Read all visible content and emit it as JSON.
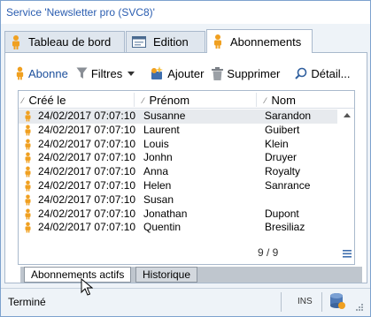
{
  "window": {
    "title": "Service 'Newsletter pro (SVC8)'"
  },
  "tabs": [
    {
      "label": "Tableau de bord",
      "icon": "person-icon"
    },
    {
      "label": "Edition",
      "icon": "form-icon"
    },
    {
      "label": "Abonnements",
      "icon": "person-icon",
      "active": true
    }
  ],
  "toolbar": {
    "abonnements_label": "Abonne",
    "filters_label": "Filtres",
    "add_label": "Ajouter",
    "delete_label": "Supprimer",
    "detail_label": "Détail..."
  },
  "grid": {
    "columns": [
      "Créé le",
      "Prénom",
      "Nom"
    ],
    "rows": [
      {
        "created": "24/02/2017 07:07:10",
        "first": "Susanne",
        "last": "Sarandon"
      },
      {
        "created": "24/02/2017 07:07:10",
        "first": "Laurent",
        "last": "Guibert"
      },
      {
        "created": "24/02/2017 07:07:10",
        "first": "Louis",
        "last": "Klein"
      },
      {
        "created": "24/02/2017 07:07:10",
        "first": "Jonhn",
        "last": "Druyer"
      },
      {
        "created": "24/02/2017 07:07:10",
        "first": "Anna",
        "last": "Royalty"
      },
      {
        "created": "24/02/2017 07:07:10",
        "first": "Helen",
        "last": "Sanrance"
      },
      {
        "created": "24/02/2017 07:07:10",
        "first": "Susan",
        "last": ""
      },
      {
        "created": "24/02/2017 07:07:10",
        "first": "Jonathan",
        "last": "Dupont"
      },
      {
        "created": "24/02/2017 07:07:10",
        "first": "Quentin",
        "last": "Bresiliaz"
      }
    ],
    "pager": "9 / 9"
  },
  "subtabs": [
    {
      "label": "Abonnements actifs",
      "active": true
    },
    {
      "label": "Historique",
      "active": false
    }
  ],
  "status": {
    "text": "Terminé",
    "mode": "INS"
  },
  "colors": {
    "person_icon": "#f0a020",
    "title_text": "#2a5db0",
    "window_bg": "#eef3f8",
    "selected_row": "#e7eaee"
  }
}
